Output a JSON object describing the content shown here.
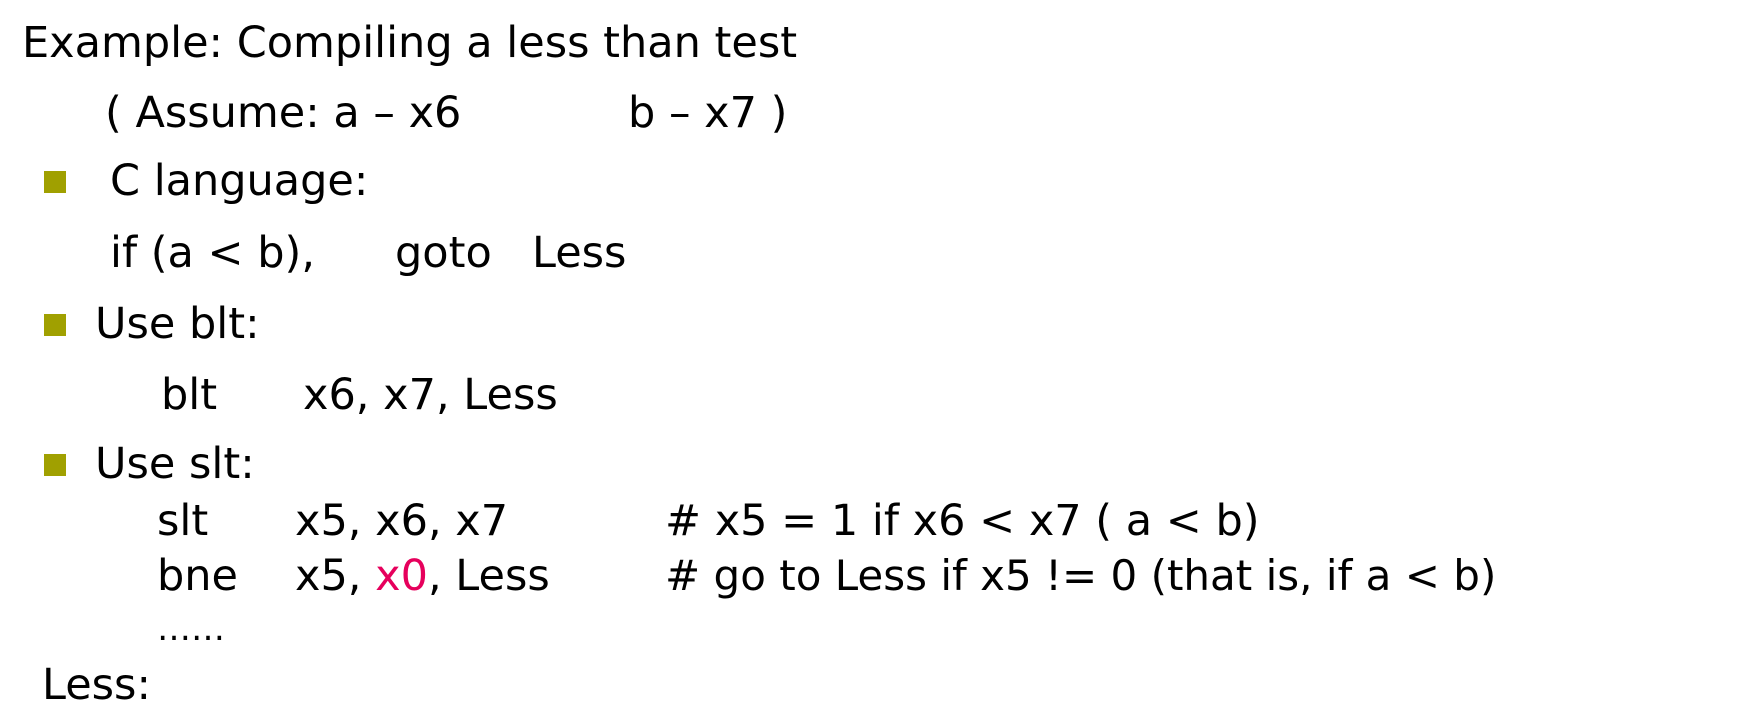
{
  "title": "Example: Compiling a less than test",
  "assume": {
    "lead": "( Assume: a – x6",
    "tail": "b – x7 )"
  },
  "colors": {
    "bullet": "#a0a000",
    "highlight": "#e6005c"
  },
  "c_language": {
    "heading": "C language:",
    "code": {
      "cond": "if (a  < b),",
      "goto": "goto",
      "label": "Less"
    }
  },
  "use_blt": {
    "heading": "Use blt:",
    "instr": {
      "op": "blt",
      "operands": "x6, x7, Less"
    }
  },
  "use_slt": {
    "heading": "Use slt:",
    "line1": {
      "op": "slt",
      "operands": "x5, x6, x7",
      "comment": "# x5 = 1  if  x6  < x7   ( a < b)"
    },
    "line2": {
      "op": "bne",
      "operands_pre": "x5, ",
      "operands_reg": "x0",
      "operands_post": ", Less",
      "comment": "# go to Less  if  x5  !=  0 (that is,  if  a  <  b)"
    },
    "ellipsis": "……"
  },
  "label": "Less:"
}
